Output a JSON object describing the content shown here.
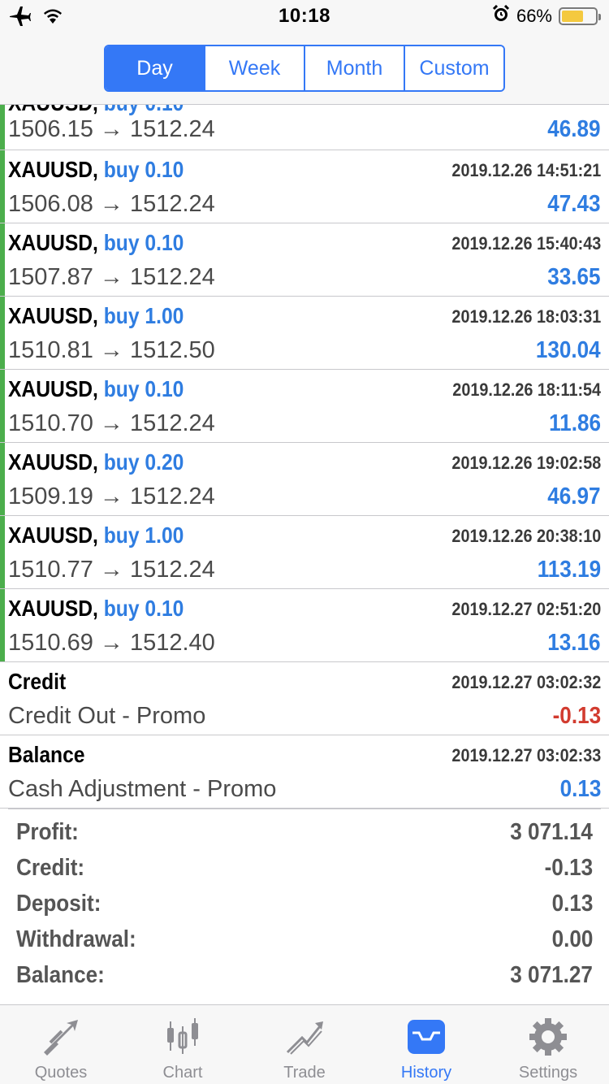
{
  "status": {
    "time": "10:18",
    "battery": "66%",
    "battery_level": 0.66,
    "icons": [
      "airplane-icon",
      "wifi-icon",
      "alarm-icon",
      "battery-icon"
    ]
  },
  "segments": [
    {
      "label": "Day",
      "active": true
    },
    {
      "label": "Week",
      "active": false
    },
    {
      "label": "Month",
      "active": false
    },
    {
      "label": "Custom",
      "active": false
    }
  ],
  "rows": [
    {
      "symbol": "XAUUSD,",
      "type": "buy 0.10",
      "time": "",
      "prices": "1506.15 → 1512.24",
      "profit": "46.89",
      "partial": true
    },
    {
      "symbol": "XAUUSD,",
      "type": "buy 0.10",
      "time": "2019.12.26 14:51:21",
      "prices": "1506.08 → 1512.24",
      "profit": "47.43"
    },
    {
      "symbol": "XAUUSD,",
      "type": "buy 0.10",
      "time": "2019.12.26 15:40:43",
      "prices": "1507.87 → 1512.24",
      "profit": "33.65"
    },
    {
      "symbol": "XAUUSD,",
      "type": "buy 1.00",
      "time": "2019.12.26 18:03:31",
      "prices": "1510.81 → 1512.50",
      "profit": "130.04"
    },
    {
      "symbol": "XAUUSD,",
      "type": "buy 0.10",
      "time": "2019.12.26 18:11:54",
      "prices": "1510.70 → 1512.24",
      "profit": "11.86"
    },
    {
      "symbol": "XAUUSD,",
      "type": "buy 0.20",
      "time": "2019.12.26 19:02:58",
      "prices": "1509.19 → 1512.24",
      "profit": "46.97"
    },
    {
      "symbol": "XAUUSD,",
      "type": "buy 1.00",
      "time": "2019.12.26 20:38:10",
      "prices": "1510.77 → 1512.24",
      "profit": "113.19"
    },
    {
      "symbol": "XAUUSD,",
      "type": "buy 0.10",
      "time": "2019.12.27 02:51:20",
      "prices": "1510.69 → 1512.40",
      "profit": "13.16"
    },
    {
      "symbol": "Credit",
      "type": "",
      "time": "2019.12.27 03:02:32",
      "prices": "Credit Out - Promo",
      "profit": "-0.13",
      "negative": true
    },
    {
      "symbol": "Balance",
      "type": "",
      "time": "2019.12.27 03:02:33",
      "prices": "Cash Adjustment - Promo",
      "profit": "0.13"
    }
  ],
  "summary": [
    {
      "label": "Profit:",
      "value": "3 071.14"
    },
    {
      "label": "Credit:",
      "value": "-0.13"
    },
    {
      "label": "Deposit:",
      "value": "0.13"
    },
    {
      "label": "Withdrawal:",
      "value": "0.00"
    },
    {
      "label": "Balance:",
      "value": "3 071.27"
    }
  ],
  "tabs": [
    {
      "label": "Quotes",
      "icon": "quotes-icon",
      "active": false
    },
    {
      "label": "Chart",
      "icon": "chart-icon",
      "active": false
    },
    {
      "label": "Trade",
      "icon": "trade-icon",
      "active": false
    },
    {
      "label": "History",
      "icon": "history-icon",
      "active": true
    },
    {
      "label": "Settings",
      "icon": "settings-icon",
      "active": false
    }
  ],
  "colors": {
    "accent": "#3478f6",
    "profit": "#2f7de1",
    "loss": "#d23b2f",
    "trade_bar": "#4cae4c"
  }
}
